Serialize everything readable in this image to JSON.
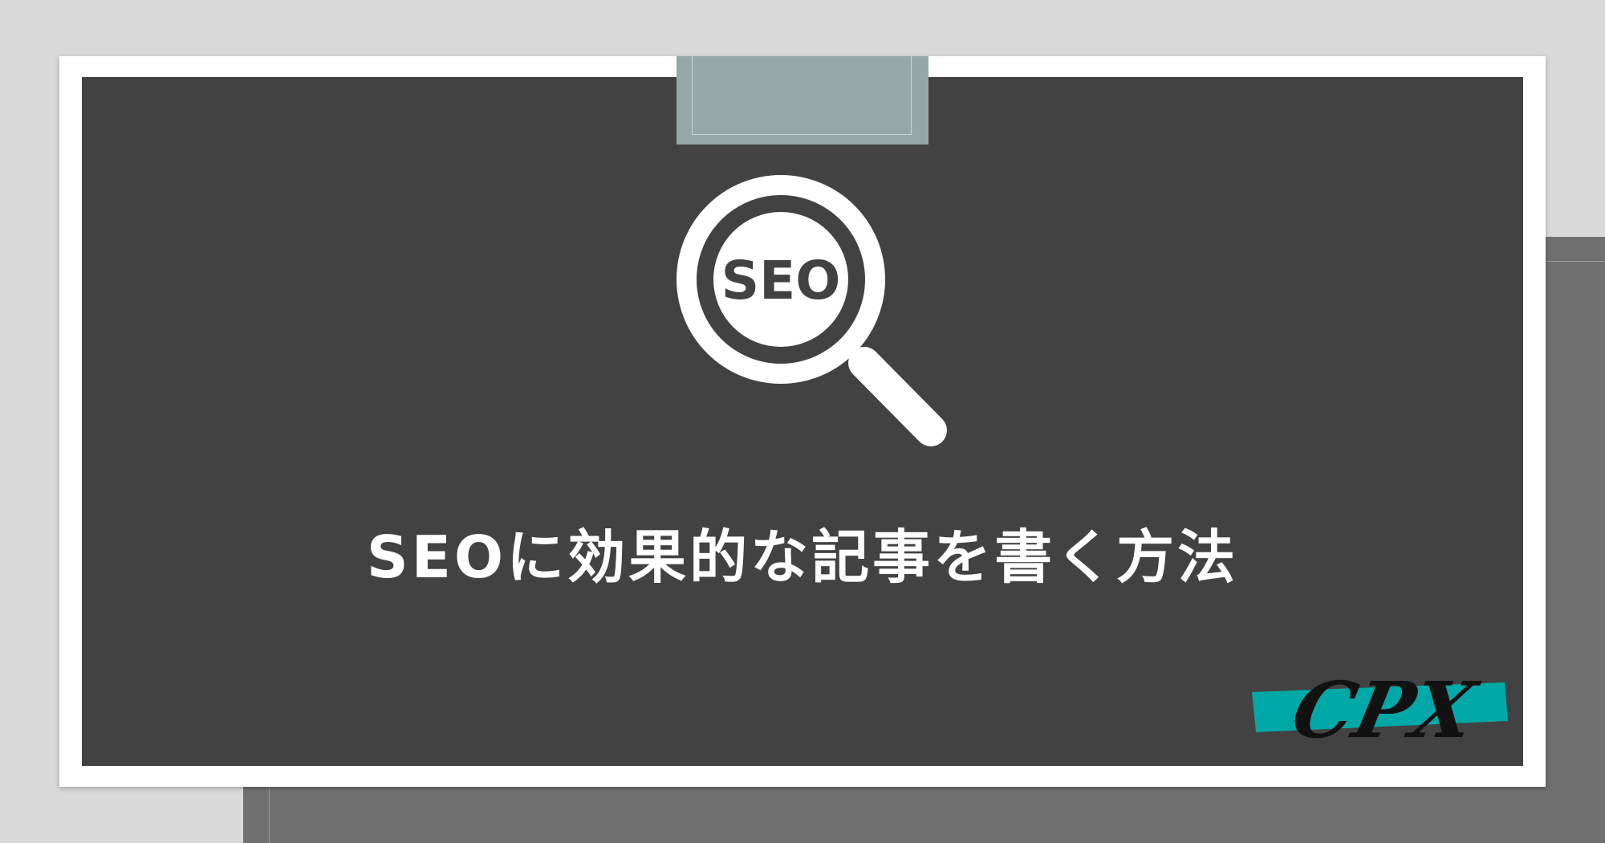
{
  "hero": {
    "icon_text": "SEO",
    "title": "SEOに効果的な記事を書く方法"
  },
  "logo": {
    "text": "CPX"
  },
  "colors": {
    "page_background": "#d9d9d9",
    "frame": "#ffffff",
    "board": "#424242",
    "tape": "#95a8a7",
    "icon": "#ffffff",
    "logo_band": "#00a8a8",
    "logo_text": "#111111"
  },
  "icons": {
    "magnifier": "magnifier-icon"
  }
}
